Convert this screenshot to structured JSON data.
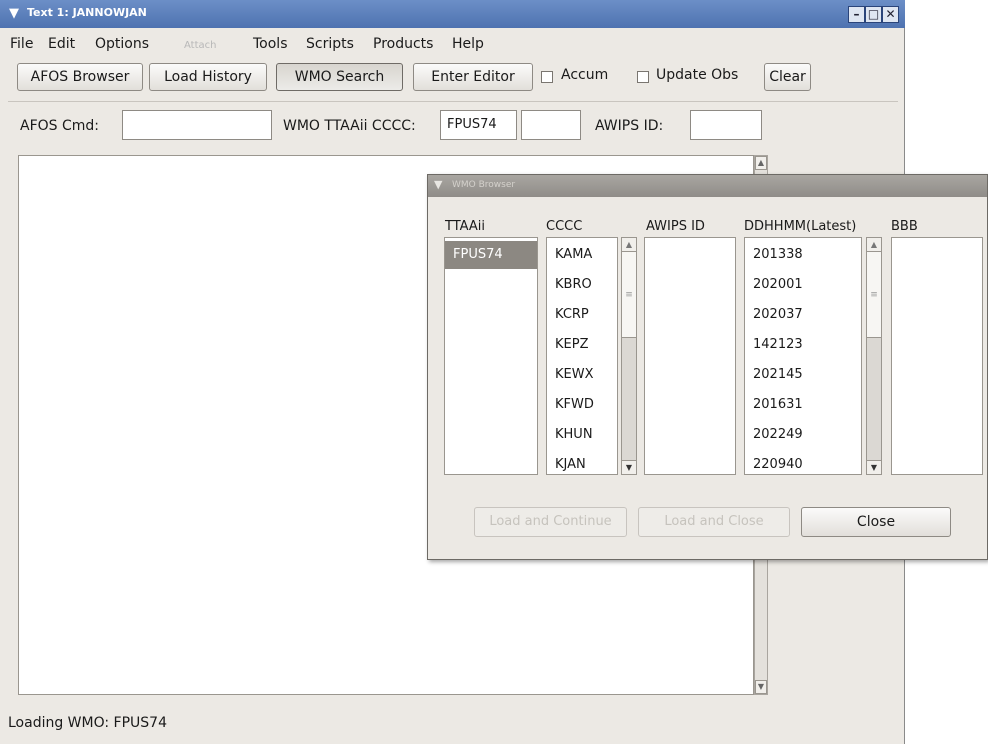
{
  "window": {
    "title": "Text 1: JANNOWJAN"
  },
  "menubar": [
    "File",
    "Edit",
    "Options",
    "Attach",
    "Tools",
    "Scripts",
    "Products",
    "Help"
  ],
  "toolbar": {
    "afos_browser": "AFOS Browser",
    "load_history": "Load History",
    "wmo_search": "WMO Search",
    "enter_editor": "Enter Editor",
    "accum": "Accum",
    "update_obs": "Update Obs",
    "clear": "Clear"
  },
  "command_row": {
    "afos_cmd_label": "AFOS Cmd:",
    "afos_cmd_value": "",
    "wmo_label": "WMO TTAAii CCCC:",
    "wmo_ttaaii_value": "FPUS74",
    "wmo_cccc_value": "",
    "awips_label": "AWIPS ID:",
    "awips_value": ""
  },
  "status": "Loading WMO: FPUS74",
  "dialog": {
    "title": "WMO Browser",
    "columns": {
      "ttaaii": "TTAAii",
      "cccc": "CCCC",
      "awips_id": "AWIPS ID",
      "ddhhmm": "DDHHMM(Latest)",
      "bbb": "BBB"
    },
    "ttaaii_items": [
      "FPUS74"
    ],
    "cccc_items": [
      "KAMA",
      "KBRO",
      "KCRP",
      "KEPZ",
      "KEWX",
      "KFWD",
      "KHUN",
      "KJAN"
    ],
    "ddhhmm_items": [
      "201338",
      "202001",
      "202037",
      "142123",
      "202145",
      "201631",
      "202249",
      "220940"
    ],
    "buttons": {
      "load_continue": "Load and Continue",
      "load_close": "Load and Close",
      "close": "Close"
    }
  },
  "colors": {
    "titlebar": "#5a7dba",
    "selected_row": "#8c8882"
  }
}
